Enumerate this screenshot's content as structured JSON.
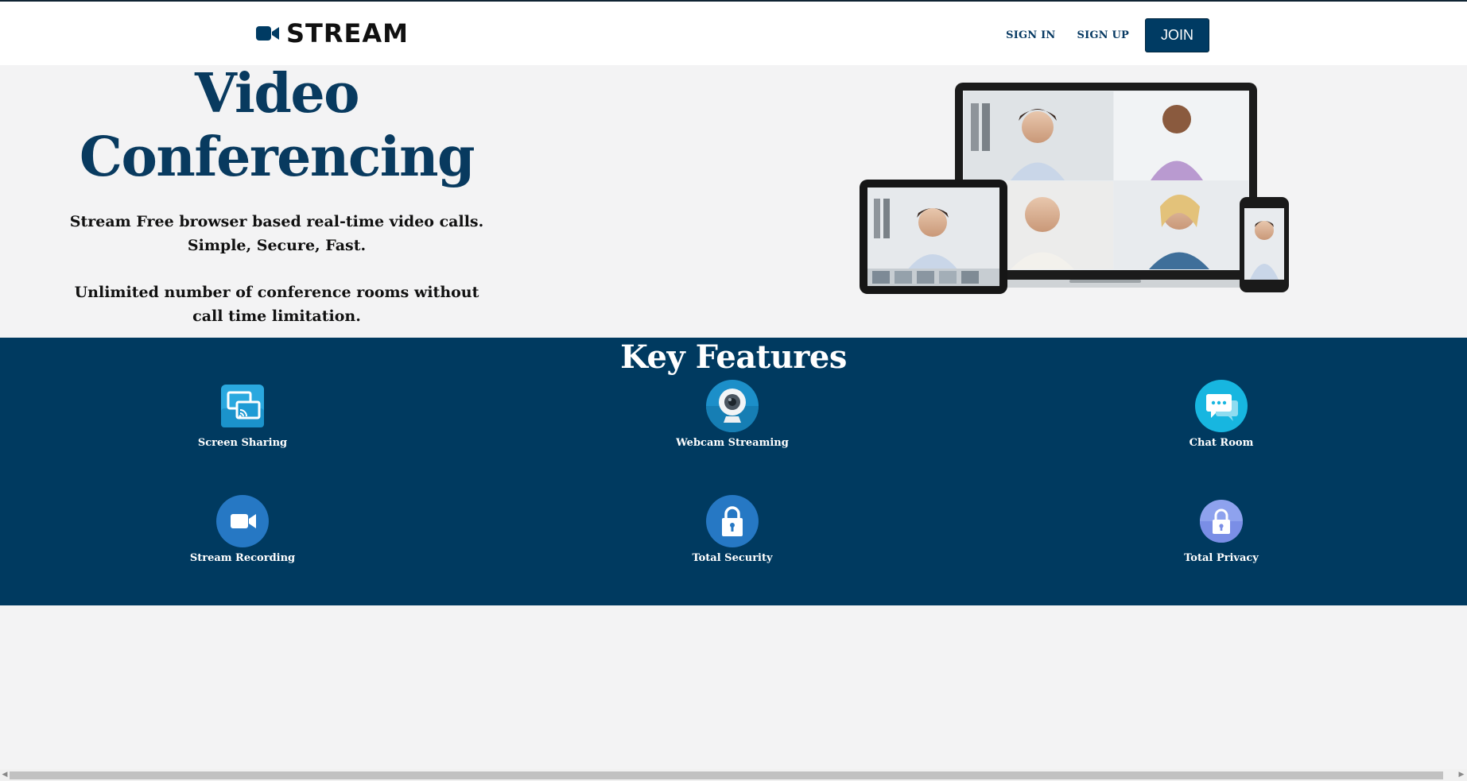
{
  "header": {
    "logo_text": "STREAM",
    "nav": {
      "sign_in": "SIGN IN",
      "sign_up": "SIGN UP",
      "join": "JOIN"
    }
  },
  "hero": {
    "title_line1": "Video",
    "title_line2": "Conferencing",
    "subtitle_line1": "Stream Free browser based real-time video calls.",
    "subtitle_line2": "Simple, Secure, Fast.",
    "description_line1": "Unlimited number of conference rooms without",
    "description_line2": "call time limitation."
  },
  "features": {
    "title": "Key Features",
    "items": [
      {
        "label": "Screen Sharing",
        "icon": "screen-sharing-icon"
      },
      {
        "label": "Webcam Streaming",
        "icon": "webcam-icon"
      },
      {
        "label": "Chat Room",
        "icon": "chat-icon"
      },
      {
        "label": "Stream Recording",
        "icon": "video-camera-icon"
      },
      {
        "label": "Total Security",
        "icon": "padlock-icon"
      },
      {
        "label": "Total Privacy",
        "icon": "privacy-lock-icon"
      }
    ]
  },
  "colors": {
    "brand_navy": "#003a60",
    "title_blue": "#083a5f",
    "background": "#f3f3f4"
  }
}
